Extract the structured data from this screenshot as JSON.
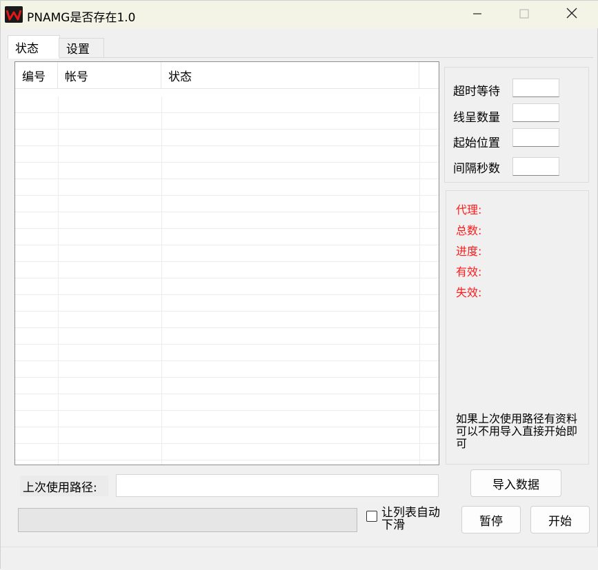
{
  "window": {
    "title": "PNAMG是否存在1.0",
    "icon": "app-logo-w-icon"
  },
  "title_buttons": {
    "minimize": "minimize-icon",
    "maximize": "maximize-icon",
    "close": "close-icon"
  },
  "tabs": [
    {
      "label": "状态",
      "active": true
    },
    {
      "label": "设置",
      "active": false
    }
  ],
  "table": {
    "columns": [
      "编号",
      "帐号",
      "状态"
    ],
    "rows": []
  },
  "settings": {
    "timeout_label": "超时等待",
    "timeout_value": "",
    "threads_label": "线呈数量",
    "threads_value": "",
    "start_pos_label": "起始位置",
    "start_pos_value": "",
    "interval_label": "间隔秒数",
    "interval_value": ""
  },
  "info": {
    "proxy_label": "代理:",
    "total_label": "总数:",
    "progress_label": "进度:",
    "valid_label": "有效:",
    "invalid_label": "失效:",
    "hint": "如果上次使用路径有资料 可以不用导入直接开始即可",
    "label_color": "#ff1a1a"
  },
  "bottom": {
    "path_label": "上次使用路径:",
    "path_value": "",
    "autoscroll_label": "让列表自动下滑",
    "autoscroll_checked": false,
    "progress": 0
  },
  "buttons": {
    "import": "导入数据",
    "pause": "暂停",
    "start": "开始"
  }
}
